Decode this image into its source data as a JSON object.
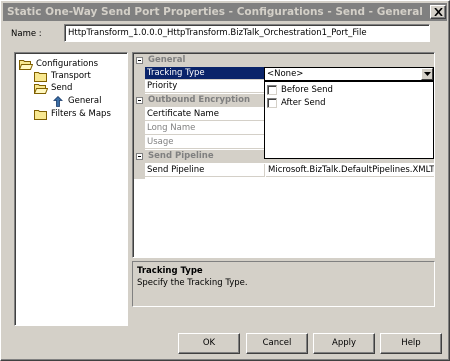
{
  "window": {
    "title": "Static One-Way Send Port Properties - Configurations - Send - General"
  },
  "name_field": {
    "label": "Name :",
    "value": "HttpTransform_1.0.0.0_HttpTransform.BizTalk_Orchestration1_Port_File"
  },
  "tree": {
    "items": [
      {
        "label": "Configurations",
        "icon": "folder-open-icon"
      },
      {
        "label": "Transport",
        "icon": "folder-icon"
      },
      {
        "label": "Send",
        "icon": "folder-open-icon"
      },
      {
        "label": "General",
        "icon": "arrow-icon"
      },
      {
        "label": "Filters & Maps",
        "icon": "folder-icon"
      }
    ]
  },
  "property_grid": {
    "categories": [
      {
        "name": "General"
      },
      {
        "name": "Outbound Encryption"
      },
      {
        "name": "Send Pipeline"
      }
    ],
    "rows": [
      {
        "name": "Tracking Type",
        "value": ""
      },
      {
        "name": "Priority",
        "value": ""
      },
      {
        "name": "Certificate Name",
        "value": ""
      },
      {
        "name": "Long Name",
        "value": ""
      },
      {
        "name": "Usage",
        "value": ""
      },
      {
        "name": "Send Pipeline",
        "value": "Microsoft.BizTalk.DefaultPipelines.XMLTransmit"
      }
    ],
    "tracking_combo": {
      "value": "<None>",
      "options": [
        "Before Send",
        "After Send"
      ]
    }
  },
  "description": {
    "title": "Tracking Type",
    "text": "Specify the Tracking Type."
  },
  "buttons": {
    "ok": "OK",
    "cancel": "Cancel",
    "apply": "Apply",
    "help": "Help"
  },
  "colors": {
    "dialog_bg": "#d4d0c8",
    "selection": "#0a246a",
    "titlebar_inactive": "#808080"
  }
}
